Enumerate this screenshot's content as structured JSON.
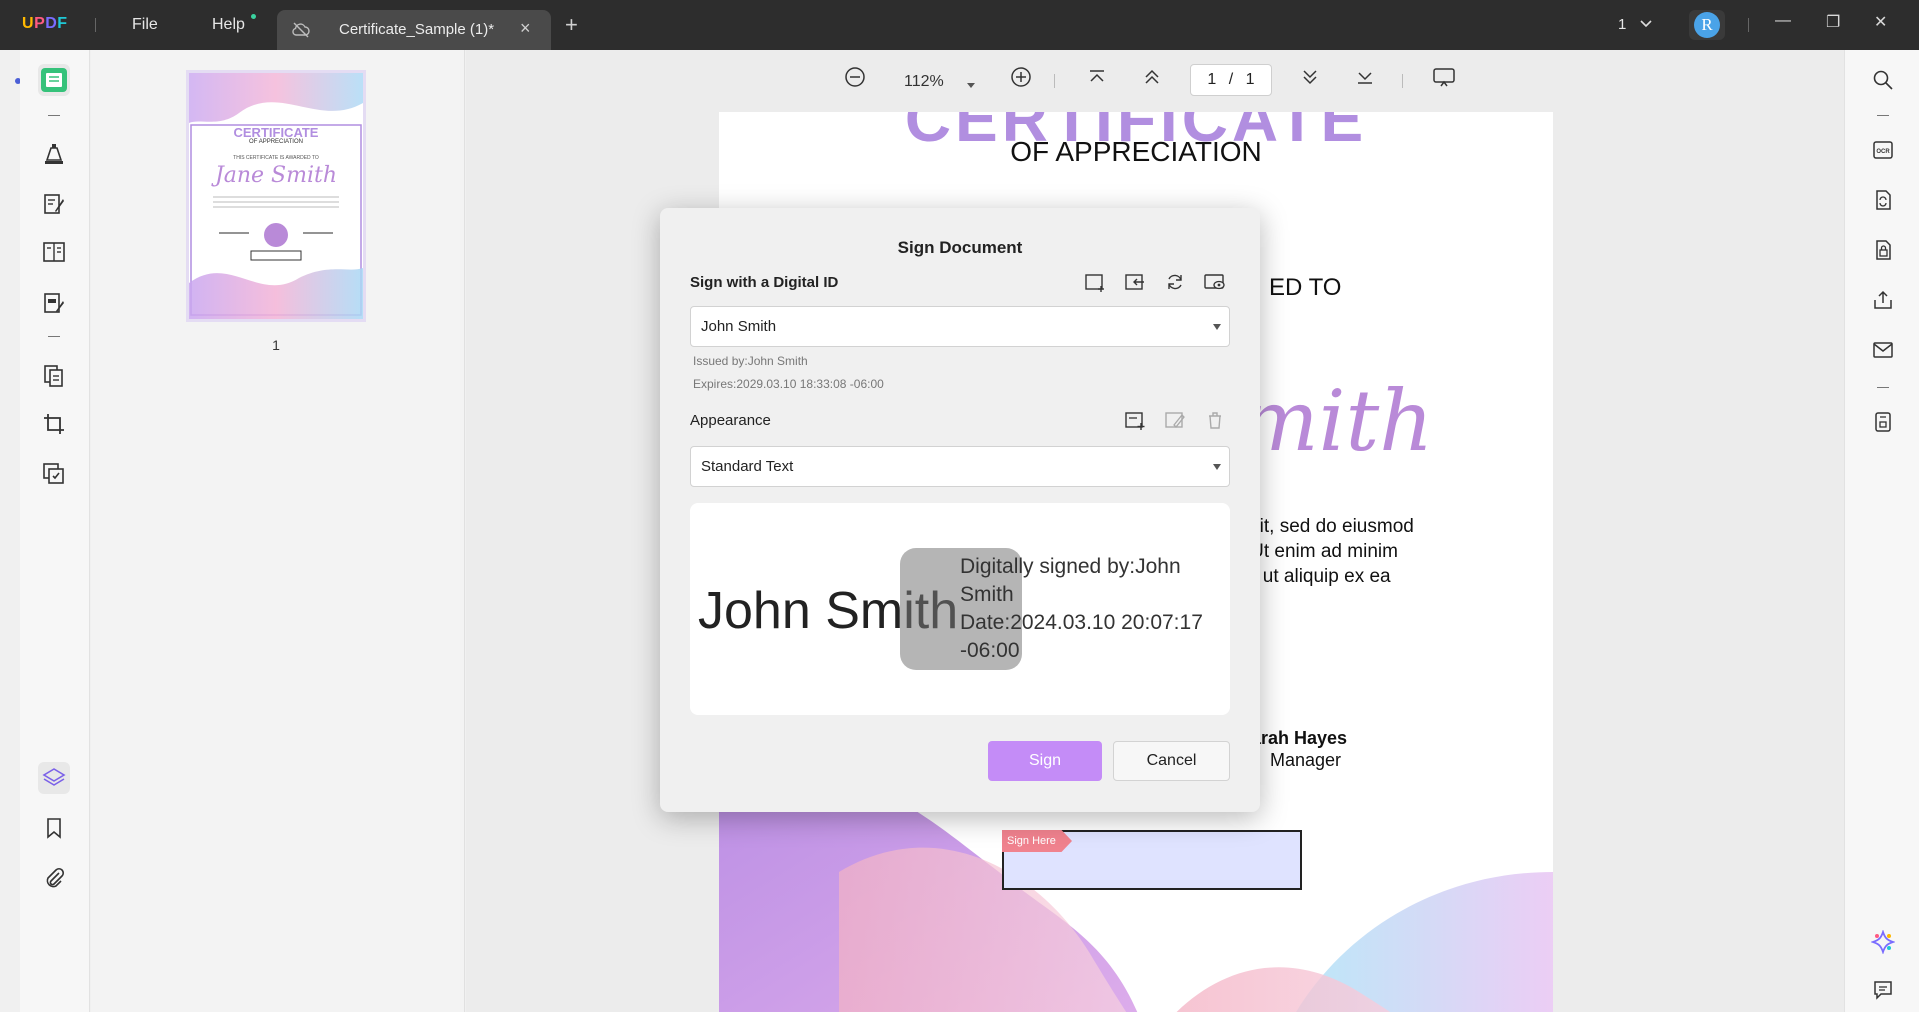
{
  "app": {
    "logo": {
      "u": "U",
      "p": "P",
      "d": "D",
      "f": "F"
    },
    "menu": {
      "file": "File",
      "help": "Help"
    },
    "tab": {
      "title": "Certificate_Sample (1)*",
      "close": "×"
    },
    "new_tab": "+",
    "page_count": "1",
    "avatar_initial": "R",
    "window": {
      "minimize": "—",
      "restore": "❐",
      "close": "✕"
    }
  },
  "view_toolbar": {
    "zoom": "112%",
    "page_input": "1",
    "page_sep": "/",
    "page_total": "1"
  },
  "thumbnail": {
    "page_number": "1",
    "title": "CERTIFICATE",
    "subtitle": "OF APPRECIATION",
    "awarded": "THIS CERTIFICATE IS AWARDED TO",
    "name": "Jane Smith"
  },
  "document": {
    "title_partial": "CERTIFICATE",
    "subtitle": "OF APPRECIATION",
    "awarded_partial": "ED TO",
    "name_partial": "mith",
    "body_lines": [
      "g elit, sed do eiusmod",
      "a. Ut enim ad minim",
      "nisi ut aliquip ex ea"
    ],
    "signer_name": "Sarah Hayes",
    "signer_role": "Manager",
    "sign_here": "Sign Here"
  },
  "dialog": {
    "title": "Sign Document",
    "digital_id_label": "Sign with a Digital ID",
    "digital_id_value": "John Smith",
    "issued_by": "Issued by:John Smith",
    "expires": "Expires:2029.03.10 18:33:08 -06:00",
    "appearance_label": "Appearance",
    "appearance_value": "Standard Text",
    "preview": {
      "name": "John Smith",
      "signed_by_line1": "Digitally signed by:John",
      "signed_by_line2": "Smith",
      "date_line1": "Date:2024.03.10 20:07:17",
      "date_line2": "-06:00"
    },
    "sign_button": "Sign",
    "cancel_button": "Cancel"
  },
  "colors": {
    "accent": "#c48cf7",
    "titlebar": "#2d2d2d",
    "avatar": "#4aa3e8",
    "sign_here": "#f0828e"
  }
}
